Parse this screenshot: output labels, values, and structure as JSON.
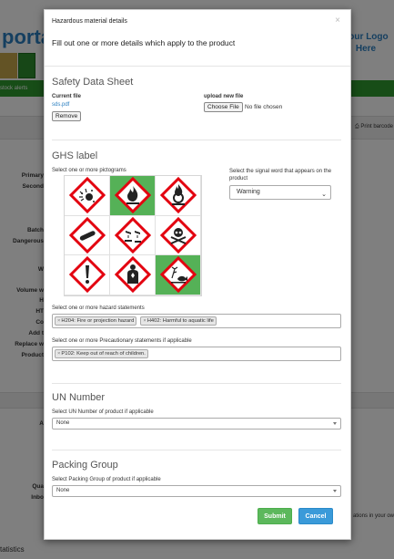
{
  "background": {
    "portal_text": "portal",
    "logo_text": "Your Logo Here",
    "stock_alerts": "stock alerts",
    "print_barcode": "Print barcode",
    "field_labels": [
      "Primary",
      "Second",
      "Batch",
      "Dangerous",
      "W",
      "Volume w",
      "H",
      "HT",
      "Co",
      "Add t",
      "Replace w",
      "Product"
    ],
    "bottom_right_text": "ations in your ow",
    "statistics": "tatistics",
    "side_labels_lower": [
      "A",
      "Qua",
      "Inbo"
    ]
  },
  "modal": {
    "title": "Hazardous material details",
    "close": "×",
    "subtitle": "Fill out one or more details which apply to the product"
  },
  "sds": {
    "title": "Safety Data Sheet",
    "current_file_label": "Current file",
    "current_file": "sds.pdf",
    "remove_label": "Remove",
    "upload_label": "upload new file",
    "choose_file_label": "Choose File",
    "no_file": "No file chosen"
  },
  "ghs": {
    "title": "GHS label",
    "pictogram_label": "Select one or more pictograms",
    "pictograms": [
      {
        "icon": "exploding-bomb-icon",
        "selected": false
      },
      {
        "icon": "flame-icon",
        "selected": true
      },
      {
        "icon": "flame-over-circle-icon",
        "selected": false
      },
      {
        "icon": "gas-cylinder-icon",
        "selected": false
      },
      {
        "icon": "corrosion-icon",
        "selected": false
      },
      {
        "icon": "skull-crossbones-icon",
        "selected": false
      },
      {
        "icon": "exclamation-mark-icon",
        "selected": false
      },
      {
        "icon": "health-hazard-icon",
        "selected": false
      },
      {
        "icon": "environment-icon",
        "selected": true
      }
    ],
    "signal_label": "Select the signal word that appears on the product",
    "signal_value": "Warning",
    "hazard_label": "Select one or more hazard statements",
    "hazard_tags": [
      "H204: Fire or projection hazard",
      "H402: Harmful to aquatic life"
    ],
    "precaution_label": "Select one or more Precautionary statements if applicable",
    "precaution_tags": [
      "P102: Keep out of reach of children."
    ]
  },
  "un": {
    "title": "UN Number",
    "label": "Select UN Number of product if applicable",
    "value": "None"
  },
  "packing": {
    "title": "Packing Group",
    "label": "Select Packing Group of product if applicable",
    "value": "None"
  },
  "actions": {
    "submit": "Submit",
    "cancel": "Cancel"
  },
  "colors": {
    "selected_cell": "#55b157",
    "submit": "#5cb85c",
    "cancel": "#3a9ad9",
    "ghs_red": "#e3000f"
  }
}
